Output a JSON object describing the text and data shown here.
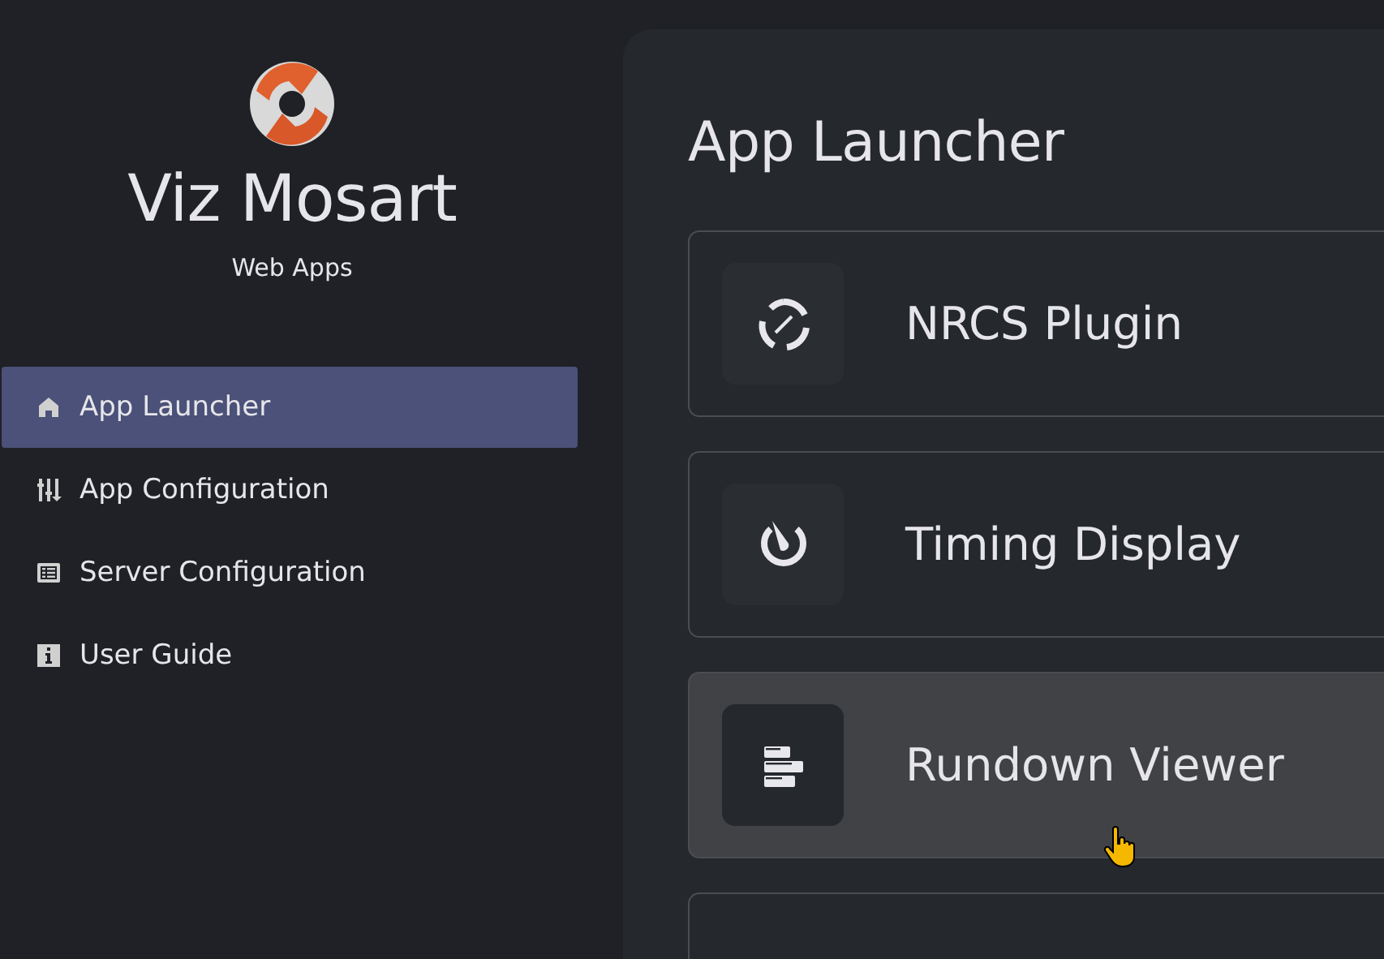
{
  "brand": {
    "title": "Viz Mosart",
    "subtitle": "Web Apps"
  },
  "nav": [
    {
      "label": "App Launcher",
      "kind": "home",
      "selected": true
    },
    {
      "label": "App Configuration",
      "kind": "sliders",
      "selected": false
    },
    {
      "label": "Server Configuration",
      "kind": "list",
      "selected": false
    },
    {
      "label": "User Guide",
      "kind": "info",
      "selected": false
    }
  ],
  "page_title": "App Launcher",
  "apps": [
    {
      "label": "NRCS Plugin",
      "kind": "plugin",
      "hovered": false
    },
    {
      "label": "Timing Display",
      "kind": "timer",
      "hovered": false
    },
    {
      "label": "Rundown Viewer",
      "kind": "rundown",
      "hovered": true
    },
    {
      "kind": "blank",
      "hovered": false
    }
  ]
}
